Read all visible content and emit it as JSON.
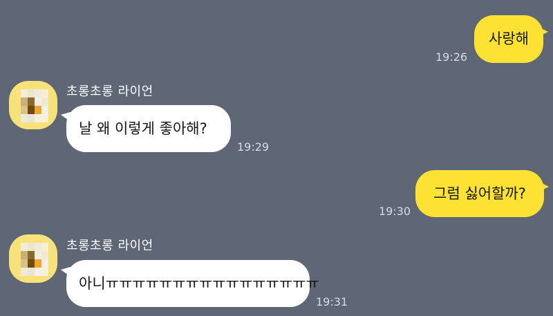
{
  "chat": {
    "messages": [
      {
        "type": "outgoing",
        "text": "사랑해",
        "time": "19:26"
      },
      {
        "type": "incoming",
        "sender": "초롱초롱 라이언",
        "text": "날 왜 이렇게 좋아해?",
        "time": "19:29"
      },
      {
        "type": "outgoing",
        "text": "그럼 싫어할까?",
        "time": "19:30"
      },
      {
        "type": "incoming",
        "sender": "초롱초롱 라이언",
        "text": "아니ㅠㅠㅠㅠㅠㅠㅠㅠㅠㅠㅠㅠㅠㅠㅠㅠ",
        "time": "19:31"
      }
    ]
  },
  "colors": {
    "background": "#5f6675",
    "outgoing_bubble": "#fee233",
    "incoming_bubble": "#ffffff",
    "avatar": "#f7e27a"
  }
}
